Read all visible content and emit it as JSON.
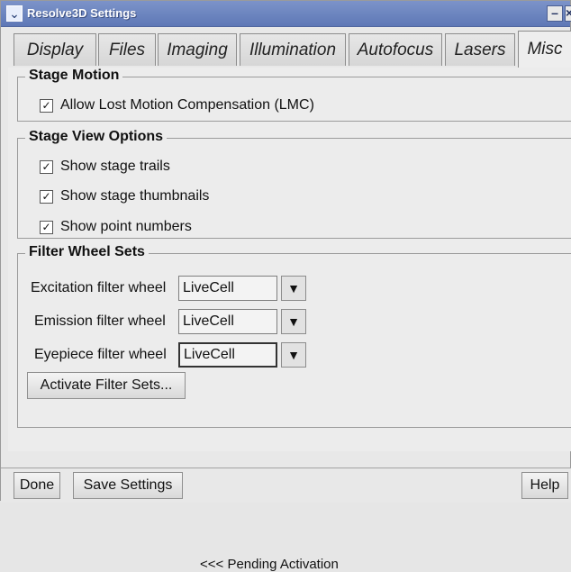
{
  "window": {
    "title": "Resolve3D Settings",
    "title_icon": "chevron-down-icon",
    "minimize_glyph": "–",
    "close_glyph": "×"
  },
  "tabs": [
    {
      "label": "Display"
    },
    {
      "label": "Files"
    },
    {
      "label": "Imaging"
    },
    {
      "label": "Illumination"
    },
    {
      "label": "Autofocus"
    },
    {
      "label": "Lasers"
    },
    {
      "label": "Misc",
      "active": true
    }
  ],
  "stage_motion": {
    "title": "Stage Motion",
    "lmc_label": "Allow Lost Motion Compensation (LMC)",
    "lmc_checked": true
  },
  "stage_view": {
    "title": "Stage View Options",
    "trails_label": "Show stage trails",
    "thumbnails_label": "Show stage thumbnails",
    "point_numbers_label": "Show point numbers",
    "trails_checked": true,
    "thumbnails_checked": true,
    "point_numbers_checked": true
  },
  "filter_wheel_sets": {
    "title": "Filter Wheel Sets",
    "excitation_label": "Excitation filter wheel",
    "excitation_value": "LiveCell",
    "emission_label": "Emission filter wheel",
    "emission_value": "LiveCell",
    "eyepiece_label": "Eyepiece filter wheel",
    "eyepiece_value": "LiveCell",
    "activate_button": "Activate Filter Sets...",
    "pending_text": "<<< Pending Activation"
  },
  "footer": {
    "done": "Done",
    "save_settings": "Save Settings",
    "help": "Help"
  },
  "colors": {
    "title_bar": "#6f86c0",
    "window_bg": "#e8e8e8"
  }
}
